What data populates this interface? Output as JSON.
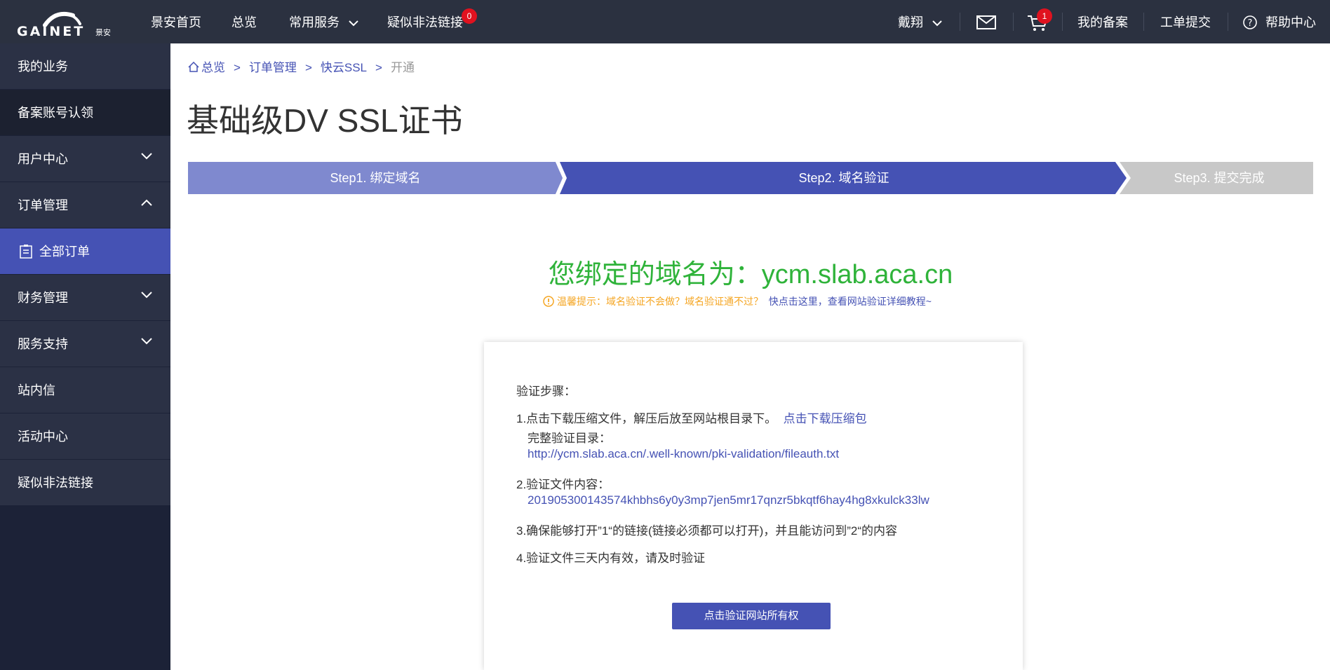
{
  "brand": {
    "name": "GAINET",
    "name_cn": "景安"
  },
  "top_nav": {
    "home": "景安首页",
    "overview": "总览",
    "services": "常用服务",
    "illegal_links": "疑似非法链接",
    "illegal_links_badge": "0",
    "user": "戴翔",
    "cart_badge": "1",
    "my_filing": "我的备案",
    "ticket_submit": "工单提交",
    "help_center": "帮助中心"
  },
  "sidebar": {
    "items": [
      {
        "label": "我的业务"
      },
      {
        "label": "备案账号认领"
      },
      {
        "label": "用户中心"
      },
      {
        "label": "订单管理"
      },
      {
        "label": "全部订单"
      },
      {
        "label": "财务管理"
      },
      {
        "label": "服务支持"
      },
      {
        "label": "站内信"
      },
      {
        "label": "活动中心"
      },
      {
        "label": "疑似非法链接"
      }
    ]
  },
  "breadcrumb": {
    "overview": "总览",
    "orders": "订单管理",
    "ssl": "快云SSL",
    "current": "开通",
    "sep": ">"
  },
  "page_title": "基础级DV SSL证书",
  "steps": [
    {
      "label": "Step1.  绑定域名",
      "state": "done",
      "color": "#7f89cf"
    },
    {
      "label": "Step2.  域名验证",
      "state": "active",
      "color": "#4552b4"
    },
    {
      "label": "Step3.  提交完成",
      "state": "pending",
      "color": "#c8c8c8"
    }
  ],
  "domain_line": "您绑定的域名为：ycm.slab.aca.cn",
  "tip": {
    "text": "温馨提示：域名验证不会做？域名验证通不过？",
    "link": "快点击这里，查看网站验证详细教程~"
  },
  "card": {
    "heading": "验证步骤：",
    "step1": "1.点击下载压缩文件，解压后放至网站根目录下。",
    "step1_link": "点击下载压缩包",
    "full_dir_label": "完整验证目录：",
    "full_dir_url": "http://ycm.slab.aca.cn/.well-known/pki-validation/fileauth.txt",
    "step2": "2.验证文件内容：",
    "step2_content": "201905300143574khbhs6y0y3mp7jen5mr17qnzr5bkqtf6hay4hg8xkulck33lw",
    "step3": "3.确保能够打开”1“的链接(链接必须都可以打开)，并且能访问到”2“的内容",
    "step4": "4.验证文件三天内有效，请及时验证",
    "button": "点击验证网站所有权"
  },
  "colors": {
    "topbar": "#2b3140",
    "sidebar": "#1c2237",
    "accent": "#4552b4",
    "domain_green": "#2fb33a",
    "tip_orange": "#f5a623"
  }
}
